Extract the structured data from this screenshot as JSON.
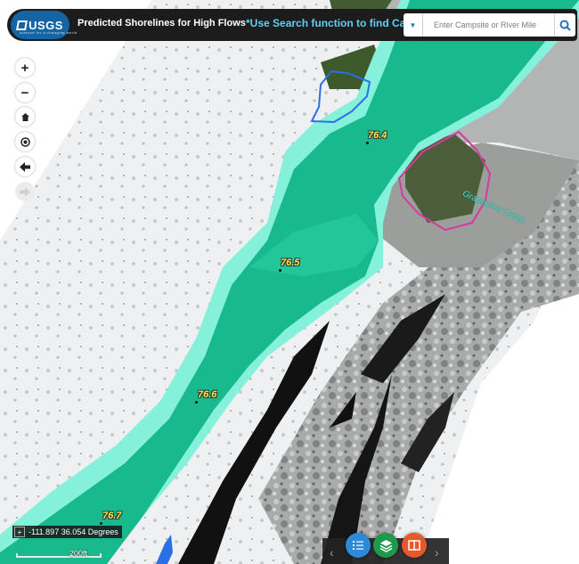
{
  "header": {
    "logo_text": "USGS",
    "logo_tagline": "science for a changing world",
    "title": "Predicted Shorelines for High Flows",
    "hint": "*Use Search function to find Camps"
  },
  "search": {
    "placeholder": "Enter Campsite or River Mile",
    "dropdown_icon": "caret-down-icon",
    "button_icon": "search-icon"
  },
  "toolbar": {
    "zoom_in": "+",
    "zoom_out": "−",
    "home_icon": "home-icon",
    "locate_icon": "locate-icon",
    "back_icon": "arrow-left-icon",
    "forward_icon": "arrow-right-icon"
  },
  "map": {
    "river_miles": [
      "76.4",
      "76.5",
      "76.6",
      "76.7"
    ],
    "campsite_label": "Grapevine Camp",
    "colors": {
      "river": "#1cbf94",
      "shoreline_high_flow": "#7ff5e1",
      "campsite_outline": "#d43a9f",
      "other_outline": "#2a6fe6"
    }
  },
  "status": {
    "coordinates": "-111.897 36.054 Degrees",
    "scale": "200ft"
  },
  "bottom_panel": {
    "prev": "‹",
    "next": "›",
    "buttons": [
      {
        "icon": "legend-list-icon",
        "color": "#2d8ad9"
      },
      {
        "icon": "layers-icon",
        "color": "#1f9a4c"
      },
      {
        "icon": "compare-split-icon",
        "color": "#e8582a"
      }
    ]
  }
}
